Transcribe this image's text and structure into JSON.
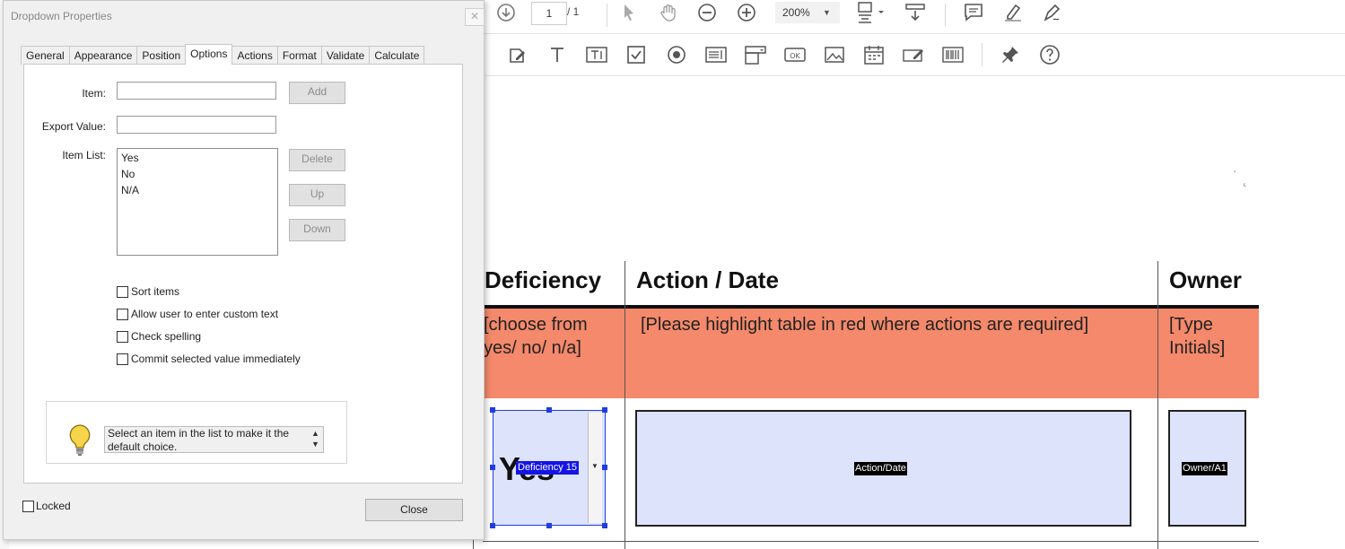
{
  "toolbar": {
    "page_current": "1",
    "page_total": "/ 1",
    "zoom": "200%"
  },
  "dialog": {
    "title": "Dropdown Properties",
    "close_symbol": "✕",
    "tabs": [
      "General",
      "Appearance",
      "Position",
      "Options",
      "Actions",
      "Format",
      "Validate",
      "Calculate"
    ],
    "active_tab": "Options",
    "item_label": "Item:",
    "item_value": "",
    "export_label": "Export Value:",
    "export_value": "",
    "add_label": "Add",
    "item_list_label": "Item List:",
    "items": [
      "Yes",
      "No",
      "N/A"
    ],
    "delete_label": "Delete",
    "up_label": "Up",
    "down_label": "Down",
    "checkboxes": [
      {
        "label": "Sort items",
        "checked": false
      },
      {
        "label": "Allow user to enter custom text",
        "checked": false
      },
      {
        "label": "Check spelling",
        "checked": false
      },
      {
        "label": "Commit selected value immediately",
        "checked": false
      }
    ],
    "hint_text": "Select an item in the list to make it the default choice.",
    "locked_label": "Locked",
    "close_label": "Close"
  },
  "document": {
    "headers": {
      "deficiency": "Deficiency",
      "action": "Action / Date",
      "owner": "Owner"
    },
    "instructions": {
      "deficiency": "[choose from yes/ no/ n/a]",
      "action": "[Please highlight table in red where actions are required]",
      "owner": "[Type Initials]"
    },
    "row_fill_color": "#f4896b",
    "fields": {
      "deficiency_value": "Yes",
      "deficiency_name": "Deficiency 15",
      "action_name": "Action/Date",
      "owner_name": "Owner/A1"
    }
  }
}
